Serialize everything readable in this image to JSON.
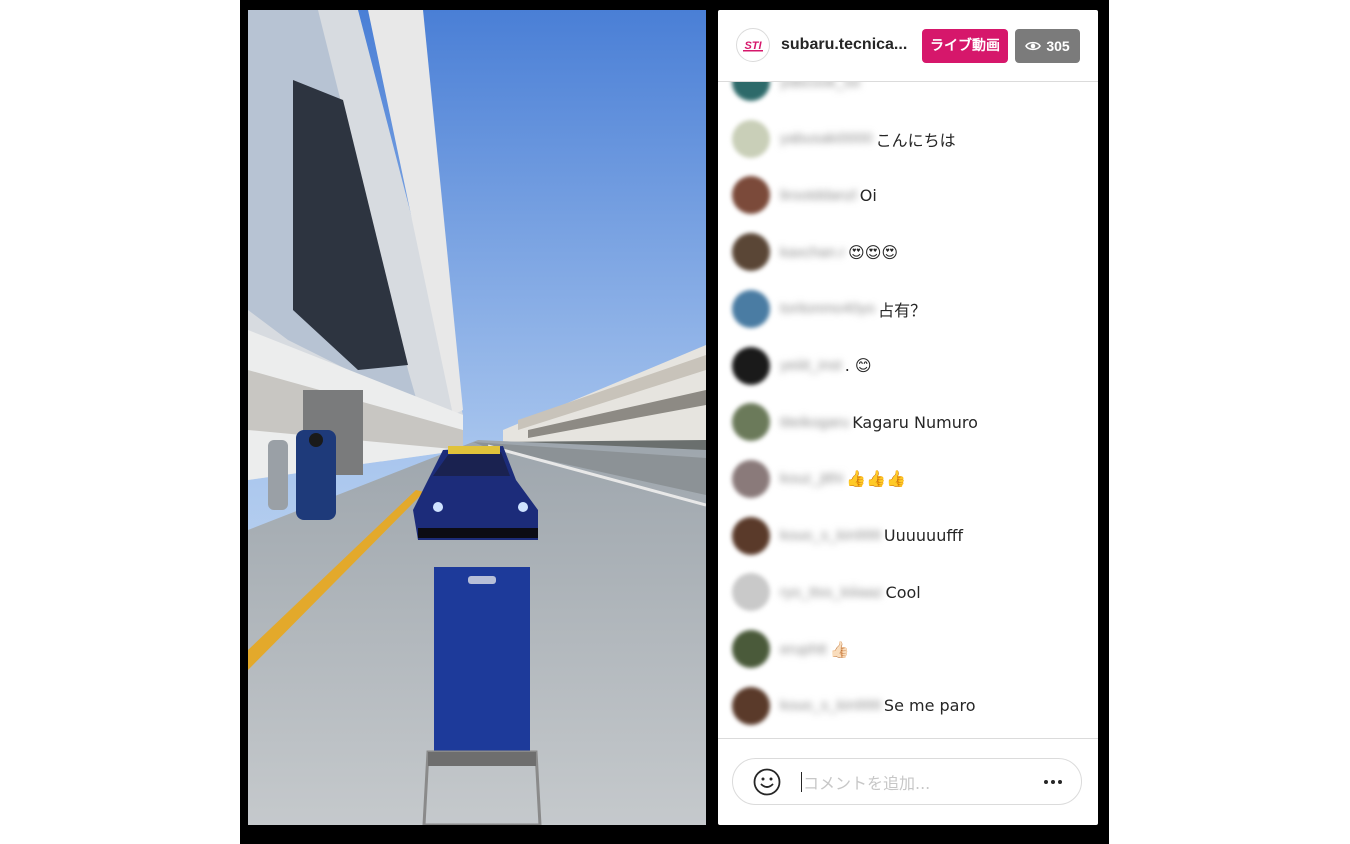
{
  "header": {
    "username": "subaru.tecnica...",
    "live_label": "ライブ動画",
    "viewer_count": "305",
    "brand_logo_text": "STI"
  },
  "comments": [
    {
      "user": "ydbcook_tst",
      "text": "",
      "avatar_color": "#2d6a6a"
    },
    {
      "user": "yabusaki0000",
      "text": "こんにちは",
      "avatar_color": "#c9cfb8"
    },
    {
      "user": "lirootddanzl",
      "text": "Oi",
      "avatar_color": "#7b4a3a"
    },
    {
      "user": "kaxchan.r",
      "text": "😍😍😍",
      "avatar_color": "#5a4636"
    },
    {
      "user": "toritonmo40yo",
      "text": "占有？",
      "avatar_color": "#4a7ca3"
    },
    {
      "user": "yeiiit_inst",
      "text": ". 😊",
      "avatar_color": "#1a1a1a"
    },
    {
      "user": "titeikogaru",
      "text": "Kagaru Numuro",
      "avatar_color": "#6b7a5a"
    },
    {
      "user": "kouz_jtthi",
      "text": "👍👍👍",
      "avatar_color": "#8a7a7a"
    },
    {
      "user": "kouo_s_kin999",
      "text": "Uuuuuufff",
      "avatar_color": "#5a3a2a"
    },
    {
      "user": "ryo_ttss_kiiiaaz",
      "text": "Cool",
      "avatar_color": "#c9c9c9"
    },
    {
      "user": "eruphtt",
      "text": "👍🏻",
      "avatar_color": "#4a5a3a"
    },
    {
      "user": "kouo_s_kin999",
      "text": "Se me paro",
      "avatar_color": "#5a3a2a"
    }
  ],
  "input": {
    "placeholder": "コメントを追加...",
    "value": ""
  },
  "icons": {
    "emoji": "smiley-face-icon",
    "more": "more-horizontal-icon",
    "viewers": "eye-icon"
  },
  "colors": {
    "live_badge": "#d6176b",
    "viewers_badge": "#7b7b7b"
  }
}
